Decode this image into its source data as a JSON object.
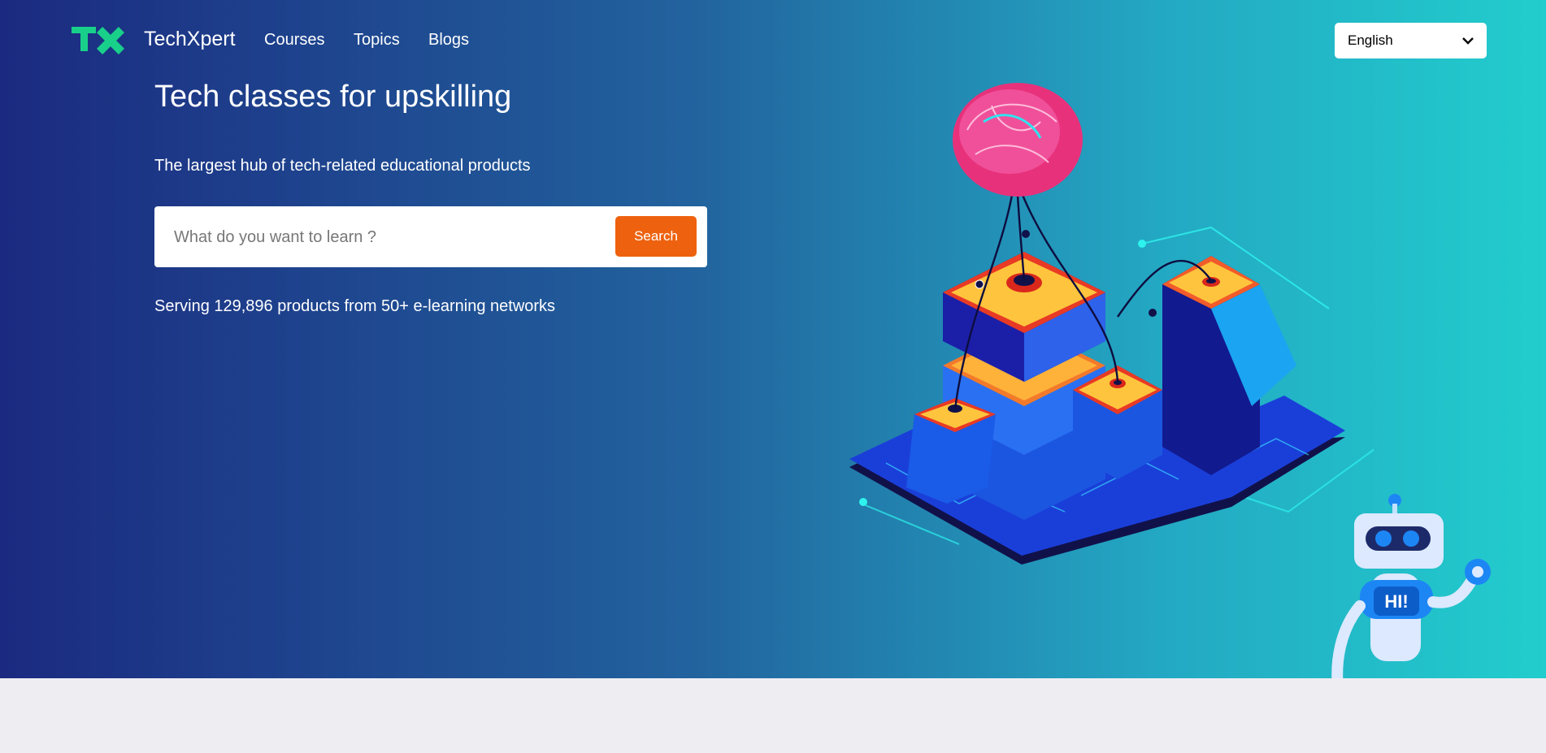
{
  "nav": {
    "logo_icon": "techxpert-logo-icon",
    "brand": "TechXpert",
    "links": [
      "Courses",
      "Topics",
      "Blogs"
    ],
    "language": {
      "selected": "English",
      "icon": "chevron-down-icon"
    }
  },
  "hero": {
    "title": "Tech classes for upskilling",
    "subtitle": "The largest hub of tech-related educational products",
    "search": {
      "placeholder": "What do you want to learn ?",
      "value": "",
      "button_label": "Search"
    },
    "stats": "Serving 129,896 products from 50+ e-learning networks",
    "illustration_icon": "isometric-brain-city-illustration",
    "robot_icon": "robot-mascot-icon",
    "robot_badge": "HI!"
  },
  "colors": {
    "gradient_start": "#1b2a80",
    "gradient_end": "#22cdcd",
    "accent": "#ee620f",
    "logo_green": "#19d08a",
    "footer_band": "#eeedf2"
  }
}
